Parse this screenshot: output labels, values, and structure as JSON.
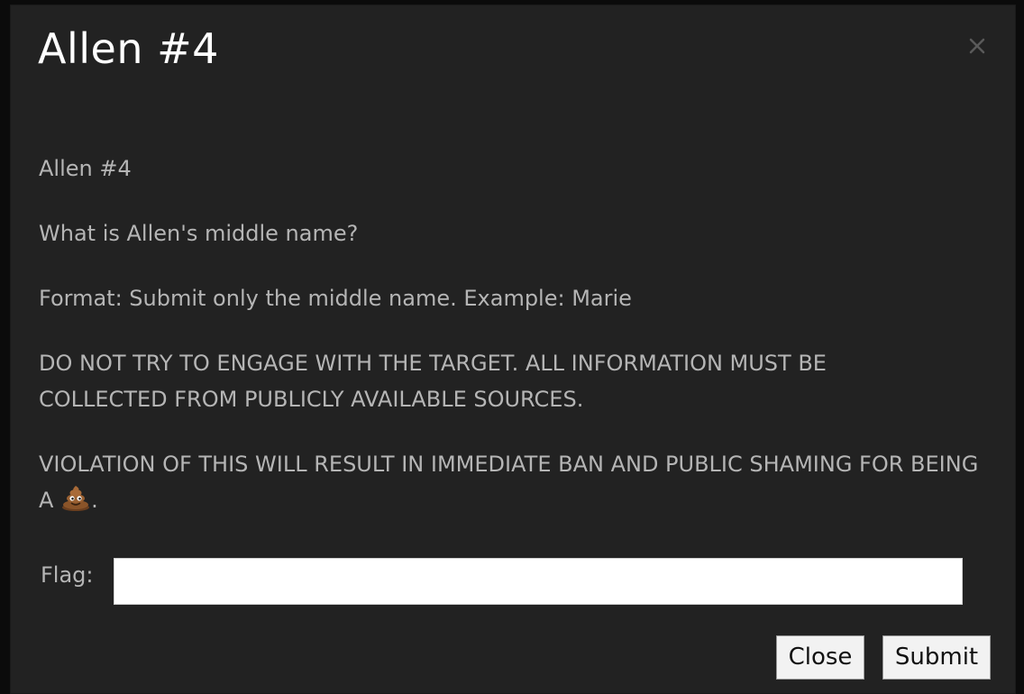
{
  "modal": {
    "title": "Allen #4",
    "close_icon": "close-icon",
    "paragraphs": [
      "Allen #4",
      "What is Allen's middle name?",
      "Format: Submit only the middle name. Example: Marie",
      "DO NOT TRY TO ENGAGE WITH THE TARGET. ALL INFORMATION MUST BE COLLECTED FROM PUBLICLY AVAILABLE SOURCES."
    ],
    "warning_text": "VIOLATION OF THIS WILL RESULT IN IMMEDIATE BAN AND PUBLIC SHAMING FOR BEING A",
    "warning_end": ".",
    "warning_icon": "poop-emoji-icon"
  },
  "form": {
    "flag_label": "Flag:",
    "flag_value": "",
    "flag_placeholder": ""
  },
  "buttons": {
    "close_label": "Close",
    "submit_label": "Submit"
  },
  "colors": {
    "modal_bg": "#222222",
    "text": "#b5b5b5",
    "title": "#ffffff"
  }
}
